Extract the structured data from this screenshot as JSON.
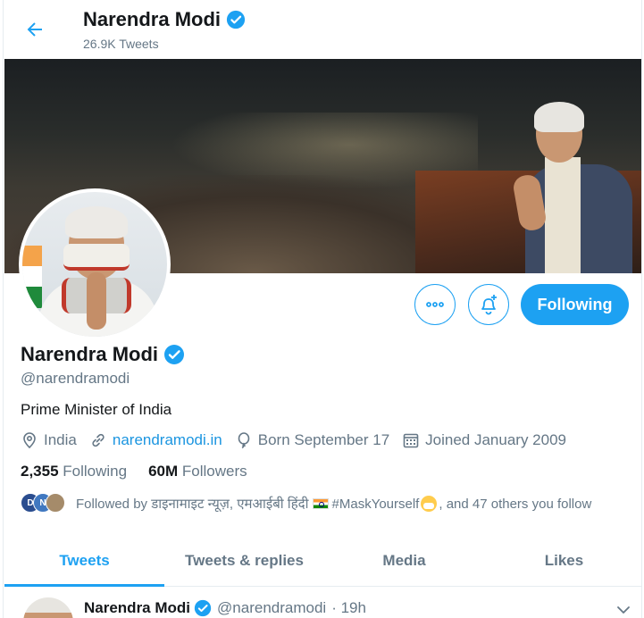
{
  "header": {
    "name": "Narendra Modi",
    "tweet_count": "26.9K Tweets"
  },
  "profile": {
    "name": "Narendra Modi",
    "handle": "@narendramodi",
    "bio": "Prime Minister of India",
    "location": "India",
    "website": "narendramodi.in",
    "born": "Born September 17",
    "joined": "Joined January 2009",
    "following_count": "2,355",
    "following_label": "Following",
    "followers_count": "60M",
    "followers_label": "Followers",
    "follow_button": "Following"
  },
  "followed_by": {
    "prefix": "Followed by डाइनामाइट न्यूज़, एमआईबी हिंदी",
    "middle": "#MaskYourself",
    "suffix": ", and 47 others you follow",
    "avatars": [
      "D",
      "N",
      ""
    ]
  },
  "tabs": [
    {
      "label": "Tweets",
      "active": true
    },
    {
      "label": "Tweets & replies",
      "active": false
    },
    {
      "label": "Media",
      "active": false
    },
    {
      "label": "Likes",
      "active": false
    }
  ],
  "tweet": {
    "name": "Narendra Modi",
    "handle": "@narendramodi",
    "time": "· 19h"
  },
  "colors": {
    "accent": "#1da1f2",
    "text": "#14171a",
    "muted": "#657786"
  },
  "icons": [
    "back-arrow-icon",
    "verified-badge-icon",
    "more-icon",
    "bell-plus-icon",
    "location-pin-icon",
    "link-icon",
    "balloon-icon",
    "calendar-icon",
    "chevron-down-icon"
  ]
}
